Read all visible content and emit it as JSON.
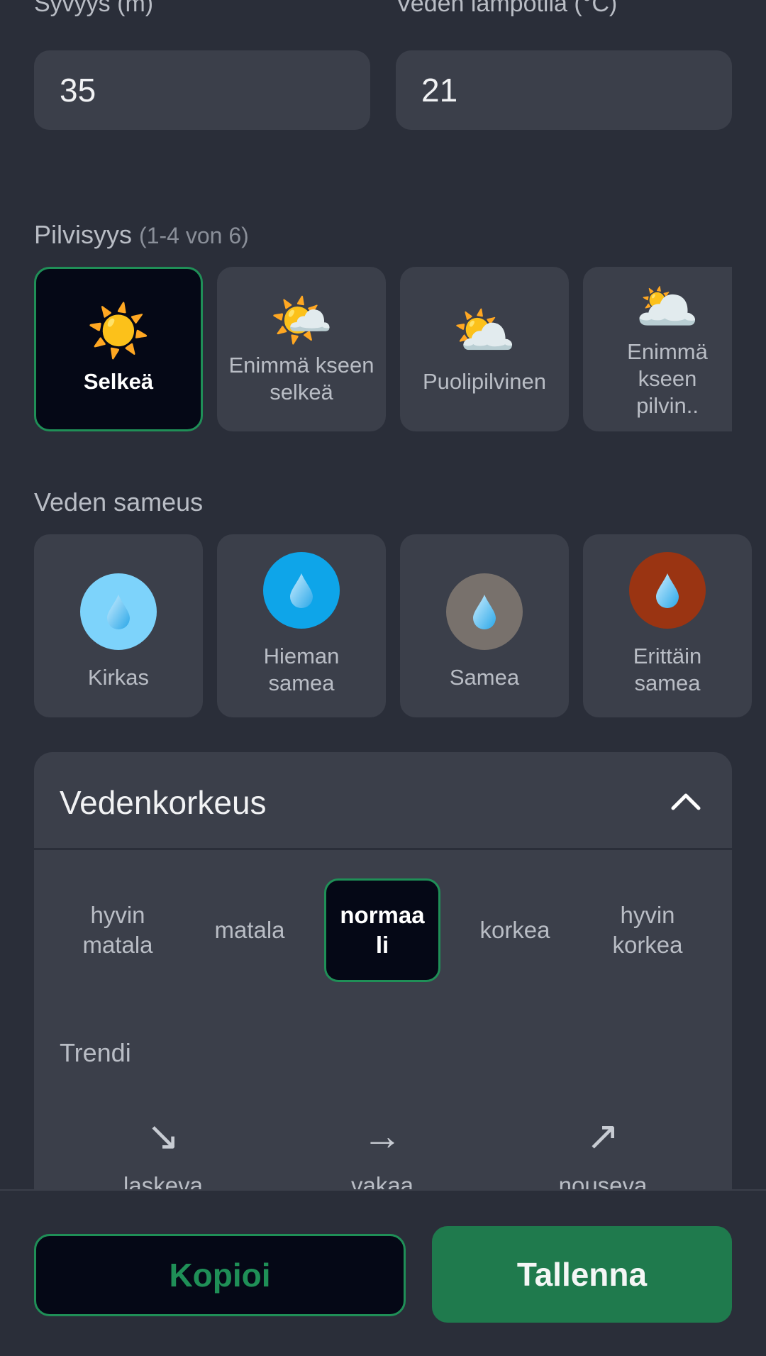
{
  "fields": {
    "depth_label": "Syvyys (m)",
    "depth_value": "35",
    "temp_label": "Veden lämpötila (°C)",
    "temp_value": "21"
  },
  "cloudiness": {
    "title": "Pilvisyys",
    "subtitle": "(1-4 von 6)",
    "options": [
      {
        "label": "Selkeä",
        "icon": "☀️",
        "icon_name": "sun-icon",
        "selected": true
      },
      {
        "label": "Enimmä kseen selkeä",
        "icon": "🌤️",
        "icon_name": "sun-small-cloud-icon",
        "selected": false
      },
      {
        "label": "Puolipilvinen",
        "icon": "⛅",
        "icon_name": "sun-behind-cloud-icon",
        "selected": false
      },
      {
        "label": "Enimmä kseen pilvin..",
        "icon": "🌥️",
        "icon_name": "sun-behind-large-cloud-icon",
        "selected": false
      }
    ]
  },
  "turbidity": {
    "title": "Veden sameus",
    "options": [
      {
        "label": "Kirkas",
        "circle_color": "#7dd3fb"
      },
      {
        "label": "Hieman samea",
        "circle_color": "#0ea5e9"
      },
      {
        "label": "Samea",
        "circle_color": "#78716c"
      },
      {
        "label": "Erittäin samea",
        "circle_color": "#9a3412"
      }
    ]
  },
  "water_level": {
    "title": "Vedenkorkeus",
    "options": [
      {
        "label": "hyvin matala",
        "selected": false
      },
      {
        "label": "matala",
        "selected": false
      },
      {
        "label": "normaa li",
        "selected": true
      },
      {
        "label": "korkea",
        "selected": false
      },
      {
        "label": "hyvin korkea",
        "selected": false
      }
    ],
    "trend_title": "Trendi",
    "trends": [
      {
        "label": "laskeva",
        "arrow": "↘",
        "icon_name": "arrow-down-right-icon"
      },
      {
        "label": "vakaa",
        "arrow": "→",
        "icon_name": "arrow-right-icon"
      },
      {
        "label": "nouseva",
        "arrow": "↗",
        "icon_name": "arrow-up-right-icon"
      }
    ]
  },
  "actions": {
    "copy_label": "Kopioi",
    "save_label": "Tallenna"
  },
  "colors": {
    "accent": "#1f8f57",
    "save_button": "#1f7a4d",
    "background": "#2a2e39",
    "card": "#3b3f4a"
  }
}
